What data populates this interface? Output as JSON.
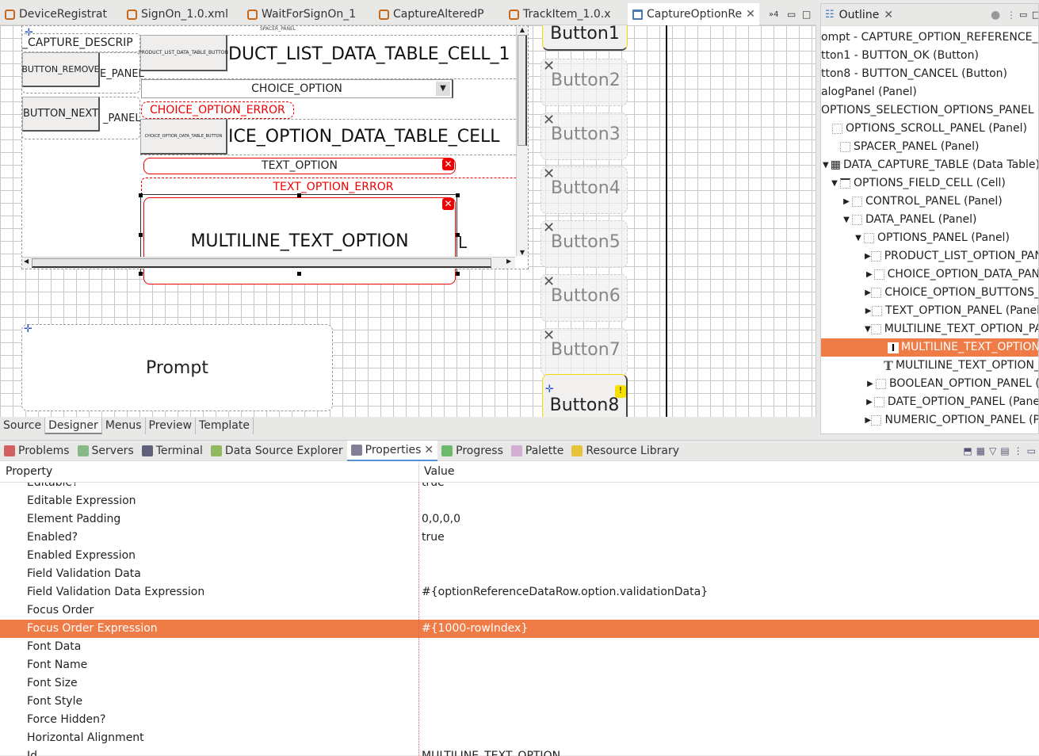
{
  "editor_tabs": [
    {
      "label": "DeviceRegistrat",
      "icon": "xml-file-icon"
    },
    {
      "label": "SignOn_1.0.xml",
      "icon": "xml-file-icon"
    },
    {
      "label": "WaitForSignOn_1",
      "icon": "xml-file-icon"
    },
    {
      "label": "CaptureAlteredP",
      "icon": "xml-file-icon"
    },
    {
      "label": "TrackItem_1.0.x",
      "icon": "xml-file-icon"
    },
    {
      "label": "CaptureOptionRe",
      "icon": "window-icon",
      "active": true
    }
  ],
  "overflow_count": "»4",
  "canvas": {
    "spacer_panel": "SPACER_PANEL",
    "capture_descrip": "_CAPTURE_DESCRIP",
    "button_remove": "BUTTON_REMOVE",
    "remove_panel": "E_PANEL",
    "button_next": "BUTTON_NEXT",
    "next_panel": "_PANEL",
    "product_btn": "PRODUCT_LIST_DATA_TABLE_BUTTON",
    "product_cell": "DUCT_LIST_DATA_TABLE_CELL_1",
    "choice_option": "CHOICE_OPTION",
    "choice_error": "CHOICE_OPTION_ERROR",
    "choice_btn": "CHOICE_OPTION_DATA_TABLE_BUTTON",
    "choice_cell": "ICE_OPTION_DATA_TABLE_CELL",
    "text_option": "TEXT_OPTION",
    "text_error": "TEXT_OPTION_ERROR",
    "multiline": "MULTILINE_TEXT_OPTION",
    "multiline_tail": "L",
    "prompt": "Prompt",
    "buttons": [
      "Button1",
      "Button2",
      "Button3",
      "Button4",
      "Button5",
      "Button6",
      "Button7",
      "Button8"
    ]
  },
  "bottom_tabs": [
    {
      "label": "Source"
    },
    {
      "label": "Designer",
      "active": true
    },
    {
      "label": "Menus"
    },
    {
      "label": "Preview"
    },
    {
      "label": "Template"
    }
  ],
  "outline": {
    "title": "Outline",
    "items": [
      {
        "label": "ompt - CAPTURE_OPTION_REFERENCE_PR",
        "indent": 0,
        "tw": "",
        "icon": ""
      },
      {
        "label": "tton1 - BUTTON_OK (Button)",
        "indent": 0,
        "tw": "",
        "icon": ""
      },
      {
        "label": "tton8 - BUTTON_CANCEL (Button)",
        "indent": 0,
        "tw": "",
        "icon": ""
      },
      {
        "label": "alogPanel (Panel)",
        "indent": 0,
        "tw": "",
        "icon": ""
      },
      {
        "label": "OPTIONS_SELECTION_OPTIONS_PANEL (P",
        "indent": 0,
        "tw": "",
        "icon": ""
      },
      {
        "label": "OPTIONS_SCROLL_PANEL (Panel)",
        "indent": 0,
        "tw": "",
        "icon": "panel"
      },
      {
        "label": "SPACER_PANEL (Panel)",
        "indent": 10,
        "tw": "",
        "icon": "panel"
      },
      {
        "label": "DATA_CAPTURE_TABLE (Data Table)",
        "indent": 0,
        "tw": "▼",
        "icon": "table"
      },
      {
        "label": "OPTIONS_FIELD_CELL (Cell)",
        "indent": 10,
        "tw": "▼",
        "icon": "cell"
      },
      {
        "label": "CONTROL_PANEL (Panel)",
        "indent": 25,
        "tw": "▶",
        "icon": "panel"
      },
      {
        "label": "DATA_PANEL (Panel)",
        "indent": 25,
        "tw": "▼",
        "icon": "panel"
      },
      {
        "label": "OPTIONS_PANEL (Panel)",
        "indent": 40,
        "tw": "▼",
        "icon": "panel"
      },
      {
        "label": "PRODUCT_LIST_OPTION_PAN",
        "indent": 55,
        "tw": "▶",
        "icon": "panel"
      },
      {
        "label": "CHOICE_OPTION_DATA_PAN",
        "indent": 55,
        "tw": "▶",
        "icon": "panel"
      },
      {
        "label": "CHOICE_OPTION_BUTTONS_",
        "indent": 55,
        "tw": "▶",
        "icon": "panel"
      },
      {
        "label": "TEXT_OPTION_PANEL (Panel",
        "indent": 55,
        "tw": "▶",
        "icon": "panel"
      },
      {
        "label": "MULTILINE_TEXT_OPTION_PA",
        "indent": 55,
        "tw": "▼",
        "icon": "panel"
      },
      {
        "label": "MULTILINE_TEXT_OPTION",
        "indent": 70,
        "tw": "",
        "icon": "textarea",
        "selected": true
      },
      {
        "label": "MULTILINE_TEXT_OPTION_",
        "indent": 70,
        "tw": "",
        "icon": "text"
      },
      {
        "label": "BOOLEAN_OPTION_PANEL (",
        "indent": 55,
        "tw": "▶",
        "icon": "panel"
      },
      {
        "label": "DATE_OPTION_PANEL (Pane",
        "indent": 55,
        "tw": "▶",
        "icon": "panel"
      },
      {
        "label": "NUMERIC_OPTION_PANEL (P",
        "indent": 55,
        "tw": "▶",
        "icon": "panel"
      }
    ]
  },
  "views": [
    {
      "label": "Problems",
      "color": "#c33"
    },
    {
      "label": "Servers",
      "color": "#6a6"
    },
    {
      "label": "Terminal",
      "color": "#335"
    },
    {
      "label": "Data Source Explorer",
      "color": "#7a3"
    },
    {
      "label": "Properties",
      "color": "#557",
      "active": true
    },
    {
      "label": "Progress",
      "color": "#4a4"
    },
    {
      "label": "Palette",
      "color": "#c9c"
    },
    {
      "label": "Resource Library",
      "color": "#e5b500"
    }
  ],
  "properties": {
    "col_property": "Property",
    "col_value": "Value",
    "rows": [
      {
        "name": "Editable?",
        "value": "true"
      },
      {
        "name": "Editable Expression",
        "value": ""
      },
      {
        "name": "Element Padding",
        "value": "0,0,0,0"
      },
      {
        "name": "Enabled?",
        "value": "true"
      },
      {
        "name": "Enabled Expression",
        "value": ""
      },
      {
        "name": "Field Validation Data",
        "value": ""
      },
      {
        "name": "Field Validation Data Expression",
        "value": "#{optionReferenceDataRow.option.validationData}"
      },
      {
        "name": "Focus Order",
        "value": ""
      },
      {
        "name": "Focus Order Expression",
        "value": "#{1000-rowIndex}",
        "selected": true
      },
      {
        "name": "Font Data",
        "value": ""
      },
      {
        "name": "Font Name",
        "value": ""
      },
      {
        "name": "Font Size",
        "value": ""
      },
      {
        "name": "Font Style",
        "value": ""
      },
      {
        "name": "Force Hidden?",
        "value": ""
      },
      {
        "name": "Horizontal Alignment",
        "value": ""
      },
      {
        "name": "Id",
        "value": "MULTILINE_TEXT_OPTION"
      }
    ]
  },
  "colors": {
    "selection": "#ef7b47",
    "error": "#ee0000",
    "active_tab_underline": "#5b8ed8"
  }
}
